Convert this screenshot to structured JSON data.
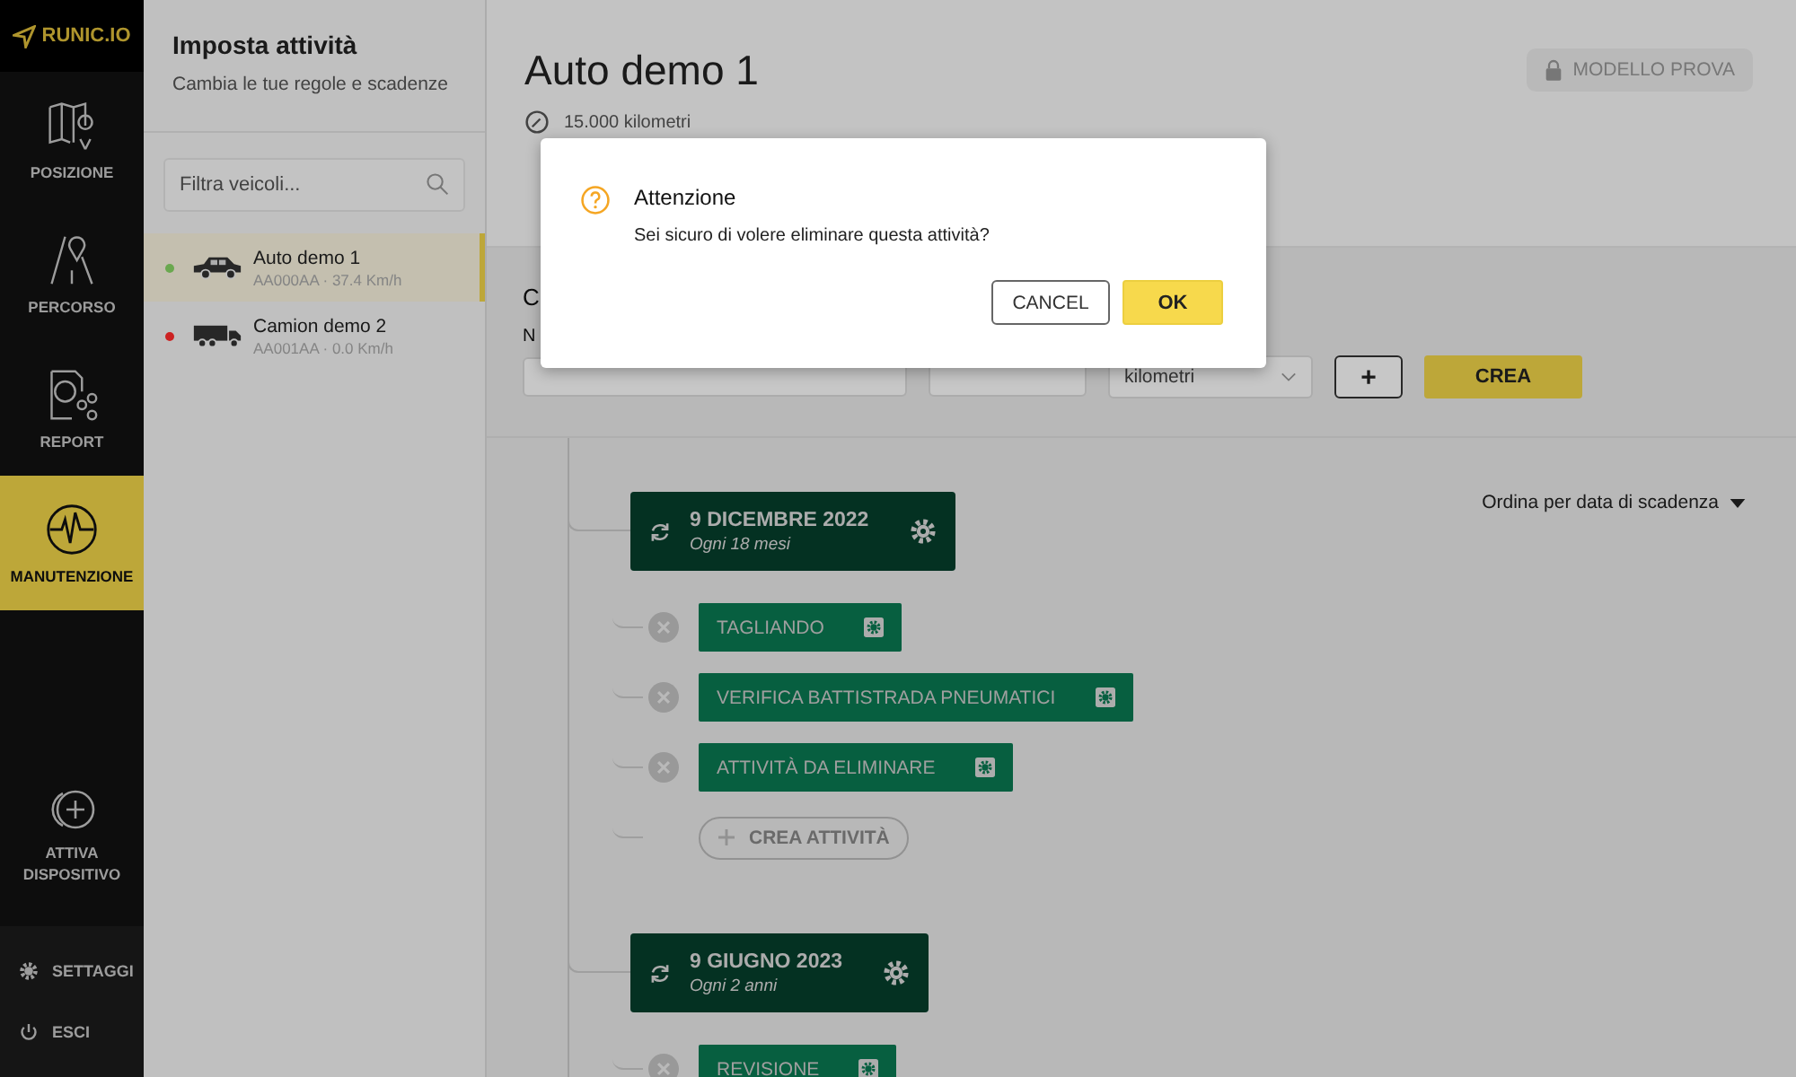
{
  "nav": {
    "logo": "RUNIC.IO",
    "items": [
      {
        "label": "POSIZIONE",
        "kind": "map",
        "selected": false
      },
      {
        "label": "PERCORSO",
        "kind": "route",
        "selected": false
      },
      {
        "label": "REPORT",
        "kind": "report",
        "selected": false
      },
      {
        "label": "MANUTENZIONE",
        "kind": "pulse",
        "selected": true
      }
    ],
    "activate": "ATTIVA DISPOSITIVO",
    "settings": "SETTAGGI",
    "logout": "ESCI"
  },
  "panel": {
    "title": "Imposta attività",
    "subtitle": "Cambia le tue regole e scadenze",
    "search": {
      "placeholder": "Filtra veicoli..."
    },
    "vehicles": [
      {
        "name": "Auto demo 1",
        "info": "AA000AA · 37.4 Km/h",
        "color": "#6aa84f",
        "kind": "car",
        "selected": true
      },
      {
        "name": "Camion demo 2",
        "info": "AA001AA · 0.0 Km/h",
        "color": "#cc2222",
        "kind": "truck",
        "selected": false
      }
    ]
  },
  "main": {
    "title": "Auto demo 1",
    "odometer": "15.000 kilometri",
    "badge": "MODELLO PROVA",
    "form": {
      "heading": "C",
      "label": "N",
      "unit": "kilometri",
      "add": "+",
      "create": "CREA"
    },
    "sort": "Ordina per data di scadenza",
    "groups": [
      {
        "date": "9 DICEMBRE 2022",
        "recurrence": "Ogni 18 mesi",
        "tasks": [
          "TAGLIANDO",
          "VERIFICA BATTISTRADA PNEUMATICI",
          "ATTIVITÀ DA ELIMINARE"
        ],
        "add": "CREA ATTIVITÀ"
      },
      {
        "date": "9 GIUGNO 2023",
        "recurrence": "Ogni 2 anni",
        "tasks": [
          "REVISIONE"
        ]
      }
    ]
  },
  "modal": {
    "title": "Attenzione",
    "message": "Sei sicuro di volere eliminare questa attività?",
    "cancel": "CANCEL",
    "ok": "OK"
  }
}
